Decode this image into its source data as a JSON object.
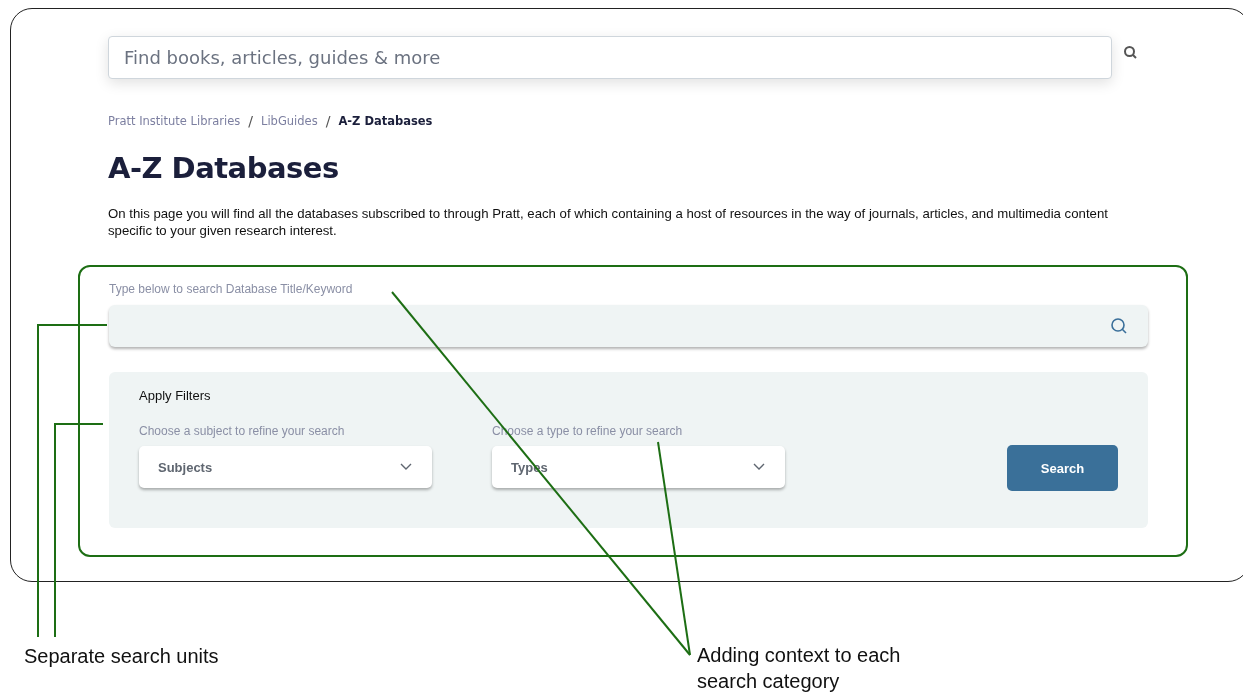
{
  "site_search": {
    "placeholder": "Find books, articles, guides & more"
  },
  "breadcrumb": [
    {
      "label": "Pratt Institute Libraries",
      "current": false
    },
    {
      "label": "LibGuides",
      "current": false
    },
    {
      "label": "A-Z Databases",
      "current": true
    }
  ],
  "breadcrumb_separator": "/",
  "title": "A-Z Databases",
  "intro": "On this page you will find all the databases subscribed to through Pratt, each of which containing a host of resources in the way of journals, articles, and multimedia content specific to your given research interest.",
  "database_search": {
    "label": "Type below to search Database Title/Keyword"
  },
  "filters": {
    "heading": "Apply Filters",
    "dropdowns": [
      {
        "label": "Choose a subject to refine your search",
        "value": "Subjects"
      },
      {
        "label": "Choose a type to refine your search",
        "value": "Types"
      }
    ],
    "button": "Search"
  },
  "annotations": [
    {
      "text": "Separate search units"
    },
    {
      "text": "Adding context to each search category"
    }
  ]
}
